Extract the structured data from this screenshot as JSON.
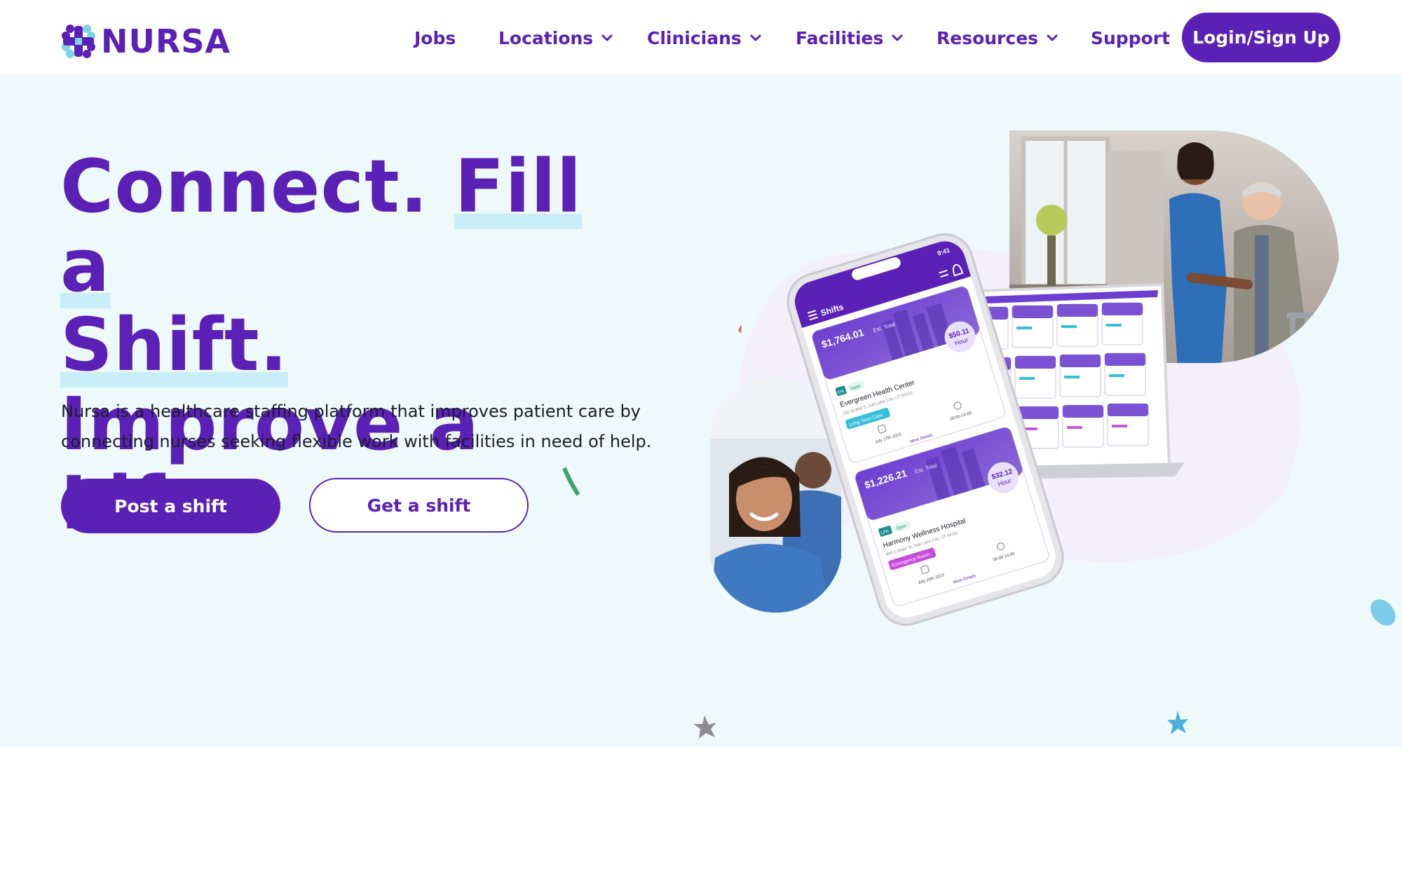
{
  "brand": {
    "name": "NURSA",
    "primary_color": "#5b21b6",
    "hero_bg": "#eef9fb"
  },
  "nav": {
    "items": [
      {
        "label": "Jobs",
        "has_dropdown": false
      },
      {
        "label": "Locations",
        "has_dropdown": true
      },
      {
        "label": "Clinicians",
        "has_dropdown": true
      },
      {
        "label": "Facilities",
        "has_dropdown": true
      },
      {
        "label": "Resources",
        "has_dropdown": true
      },
      {
        "label": "Support",
        "has_dropdown": false
      }
    ],
    "login_label": "Login/Sign Up"
  },
  "hero": {
    "headline": {
      "part1": "Connect. ",
      "part2": "Fill a",
      "part3": "Shift.",
      "part4": " Improve a Life."
    },
    "subtext": "Nursa is a healthcare staffing platform that improves patient care by connecting nurses seeking flexible work with facilities in need of help.",
    "primary_cta": "Post a shift",
    "secondary_cta": "Get a shift"
  },
  "phone": {
    "header": "Shifts",
    "status_time": "9:41",
    "cards": [
      {
        "total": "$1,764.01",
        "total_suffix": "Est. Total",
        "rate": "$50.11",
        "rate_unit": "Hour",
        "role": "RN",
        "status": "Open",
        "facility": "Evergreen Health Center",
        "address": "150 W 800 S, Salt Lake City, UT 84101",
        "tag": "Long Term Care",
        "date": "July 27th 2023",
        "time": "06:00-14:00",
        "link": "More Details"
      },
      {
        "total": "$1,226.21",
        "total_suffix": "Est. Total",
        "rate": "$32.12",
        "rate_unit": "Hour",
        "role": "LPN",
        "status": "Open",
        "facility": "Harmony Wellness Hospital",
        "address": "800 S State St, Salt Lake City, UT 84111",
        "tag": "Emergency Room",
        "date": "July 29th 2023",
        "time": "06:00-14:00",
        "link": "More Details"
      }
    ]
  },
  "icons": {
    "logo": "nursa-logo-icon",
    "dropdown": "chevron-down-icon",
    "menu": "hamburger-icon",
    "filter": "filter-icon",
    "bell": "bell-icon",
    "calendar": "calendar-icon",
    "clock": "clock-icon"
  }
}
